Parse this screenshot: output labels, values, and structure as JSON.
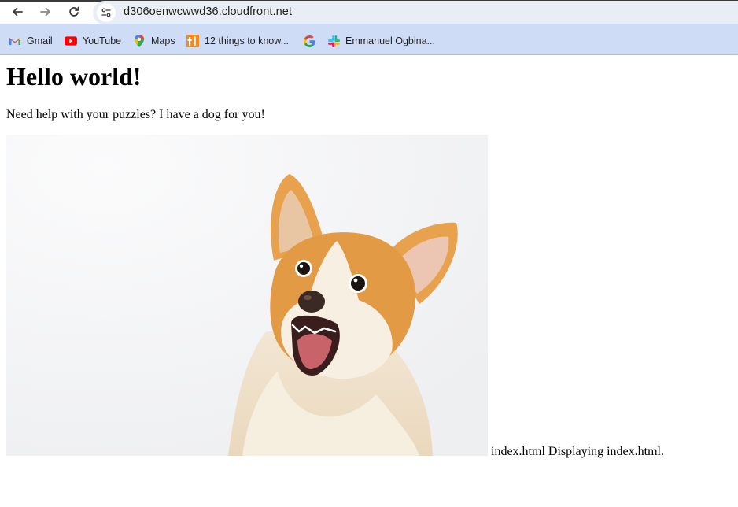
{
  "browser": {
    "url": "d306oenwcwwd36.cloudfront.net",
    "bookmarks": [
      {
        "label": "Gmail",
        "icon": "gmail-icon"
      },
      {
        "label": "YouTube",
        "icon": "youtube-icon"
      },
      {
        "label": "Maps",
        "icon": "maps-icon"
      },
      {
        "label": "12 things to know...",
        "icon": "tl-bookmark-icon"
      },
      {
        "label": "",
        "icon": "google-icon"
      },
      {
        "label": "Emmanuel Ogbina...",
        "icon": "slack-icon"
      }
    ]
  },
  "page": {
    "heading": "Hello world!",
    "lead": "Need help with your puzzles? I have a dog for you!",
    "image_alt": "Surprised corgi dog",
    "caption": "index.html Displaying index.html."
  },
  "colors": {
    "bookmark_bar": "#cfdcf6",
    "omnibox": "#e9edf5",
    "youtube_red": "#ff0000"
  }
}
